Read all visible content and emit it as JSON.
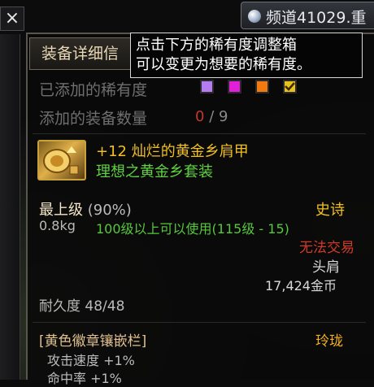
{
  "close_label": "×",
  "channel": {
    "label": "频道41029.重"
  },
  "tabs": {
    "detail": "装备详细信"
  },
  "hint": {
    "line1": "点击下方的稀有度调整箱",
    "line2": "可以变更为想要的稀有度。"
  },
  "added_rarity": {
    "label": "已添加的稀有度",
    "colors": [
      "#b57cf0",
      "#e21fd8",
      "#f07a10",
      "#e8c020"
    ]
  },
  "added_count": {
    "label": "添加的装备数量",
    "current": "0",
    "separator": "/",
    "max": "9"
  },
  "item": {
    "name": "+12 灿烂的黄金乡肩甲",
    "set": "理想之黄金乡套装",
    "grade": "最上级",
    "grade_pct": "(90%)",
    "rarity": "史诗",
    "weight": "0.8kg",
    "level_req": "100级以上可以使用(115级 - 15)",
    "trade": "无法交易",
    "slot": "头肩",
    "price": "17,424金币",
    "durability": "耐久度 48/48",
    "socket": "[黄色徽章镶嵌栏]",
    "socket_type": "玲珑",
    "stats": [
      "攻击速度 +1%",
      "命中率 +1%"
    ]
  }
}
